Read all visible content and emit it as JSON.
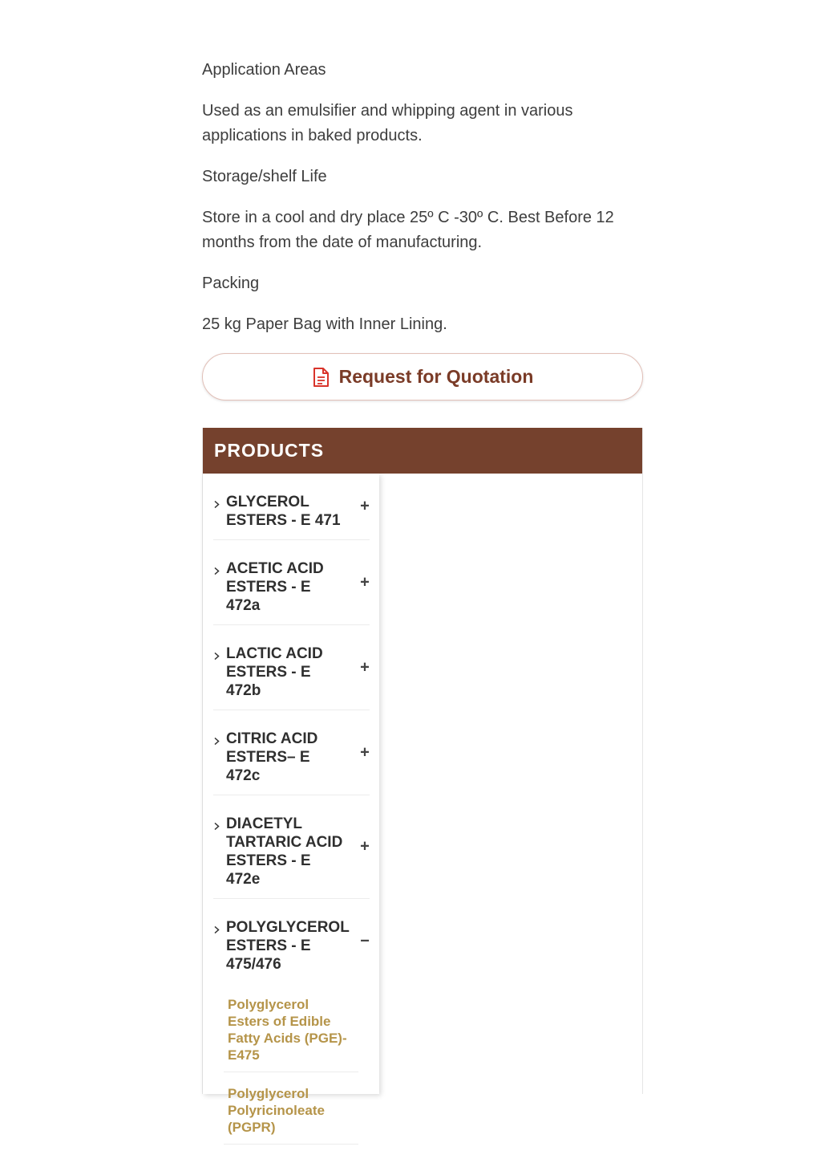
{
  "details": {
    "application_heading": "Application Areas",
    "application_text": "Used as an emulsifier and whipping agent in various applications in baked products.",
    "storage_heading": "Storage/shelf Life",
    "storage_text": "Store in a cool and dry place 25º C -30º C. Best Before 12 months from the date of manufacturing.",
    "packing_heading": "Packing",
    "packing_text": "25 kg Paper Bag with Inner Lining."
  },
  "rfq": {
    "label": "Request for Quotation",
    "icon": "document-icon"
  },
  "products": {
    "title": "PRODUCTS",
    "items": [
      {
        "label": "GLYCEROL ESTERS - E 471",
        "toggle": "+"
      },
      {
        "label": "ACETIC ACID ESTERS - E 472a",
        "toggle": "+"
      },
      {
        "label": "LACTIC ACID ESTERS - E 472b",
        "toggle": "+"
      },
      {
        "label": "CITRIC ACID ESTERS– E 472c",
        "toggle": "+"
      },
      {
        "label": "DIACETYL TARTARIC ACID ESTERS - E 472e",
        "toggle": "+"
      },
      {
        "label": "POLYGLYCEROL ESTERS - E 475/476",
        "toggle": "−"
      }
    ],
    "subitems": [
      {
        "label": "Polyglycerol Esters of Edible Fatty Acids (PGE)- E475"
      },
      {
        "label": "Polyglycerol Polyricinoleate (PGPR)"
      }
    ]
  },
  "colors": {
    "header_bg": "#75412d",
    "rfq_text": "#7a3b27",
    "rfq_icon": "#d9342b",
    "subitem_text": "#b59449"
  }
}
